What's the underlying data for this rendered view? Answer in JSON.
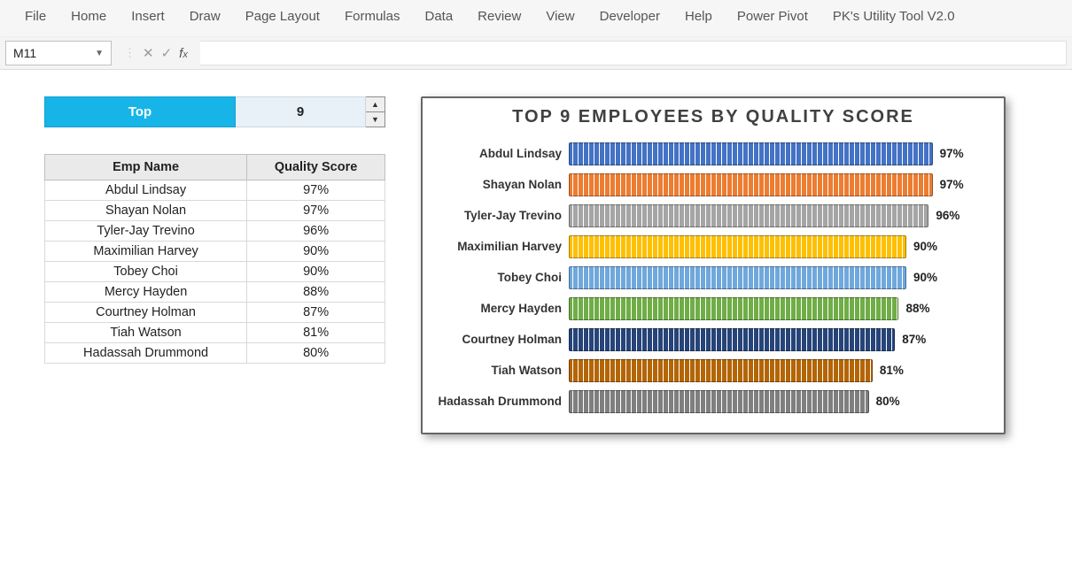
{
  "menu": [
    "File",
    "Home",
    "Insert",
    "Draw",
    "Page Layout",
    "Formulas",
    "Data",
    "Review",
    "View",
    "Developer",
    "Help",
    "Power Pivot",
    "PK's Utility Tool V2.0"
  ],
  "nameBox": "M11",
  "selector": {
    "label": "Top",
    "value": "9"
  },
  "table": {
    "headers": [
      "Emp Name",
      "Quality Score"
    ],
    "rows": [
      [
        "Abdul Lindsay",
        "97%"
      ],
      [
        "Shayan Nolan",
        "97%"
      ],
      [
        "Tyler-Jay Trevino",
        "96%"
      ],
      [
        "Maximilian Harvey",
        "90%"
      ],
      [
        "Tobey Choi",
        "90%"
      ],
      [
        "Mercy Hayden",
        "88%"
      ],
      [
        "Courtney Holman",
        "87%"
      ],
      [
        "Tiah Watson",
        "81%"
      ],
      [
        "Hadassah Drummond",
        "80%"
      ]
    ]
  },
  "chart_data": {
    "type": "bar",
    "title": "TOP 9 EMPLOYEES BY QUALITY SCORE",
    "xlabel": "",
    "ylabel": "",
    "ylim": [
      0,
      100
    ],
    "categories": [
      "Abdul Lindsay",
      "Shayan Nolan",
      "Tyler-Jay Trevino",
      "Maximilian Harvey",
      "Tobey Choi",
      "Mercy Hayden",
      "Courtney Holman",
      "Tiah Watson",
      "Hadassah Drummond"
    ],
    "values": [
      97,
      97,
      96,
      90,
      90,
      88,
      87,
      81,
      80
    ],
    "labels": [
      "97%",
      "97%",
      "96%",
      "90%",
      "90%",
      "88%",
      "87%",
      "81%",
      "80%"
    ],
    "colors": [
      "#4472c4",
      "#ed7d31",
      "#a5a5a5",
      "#ffc000",
      "#6fa8dc",
      "#70ad47",
      "#264478",
      "#b46504",
      "#7f7f7f"
    ]
  }
}
